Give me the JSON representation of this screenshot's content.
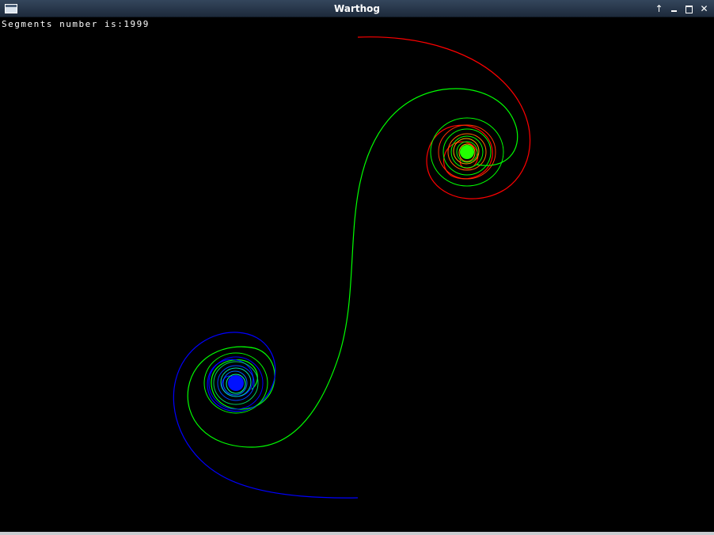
{
  "window": {
    "title": "Warthog",
    "controls": {
      "up": "↑",
      "minimize": "",
      "maximize": "",
      "close": "✕"
    }
  },
  "status": {
    "text": "Segments number is:1999"
  },
  "colors": {
    "background": "#000000",
    "red_curve": "#ff0000",
    "green_curve": "#00ff00",
    "blue_curve": "#0000ff"
  }
}
